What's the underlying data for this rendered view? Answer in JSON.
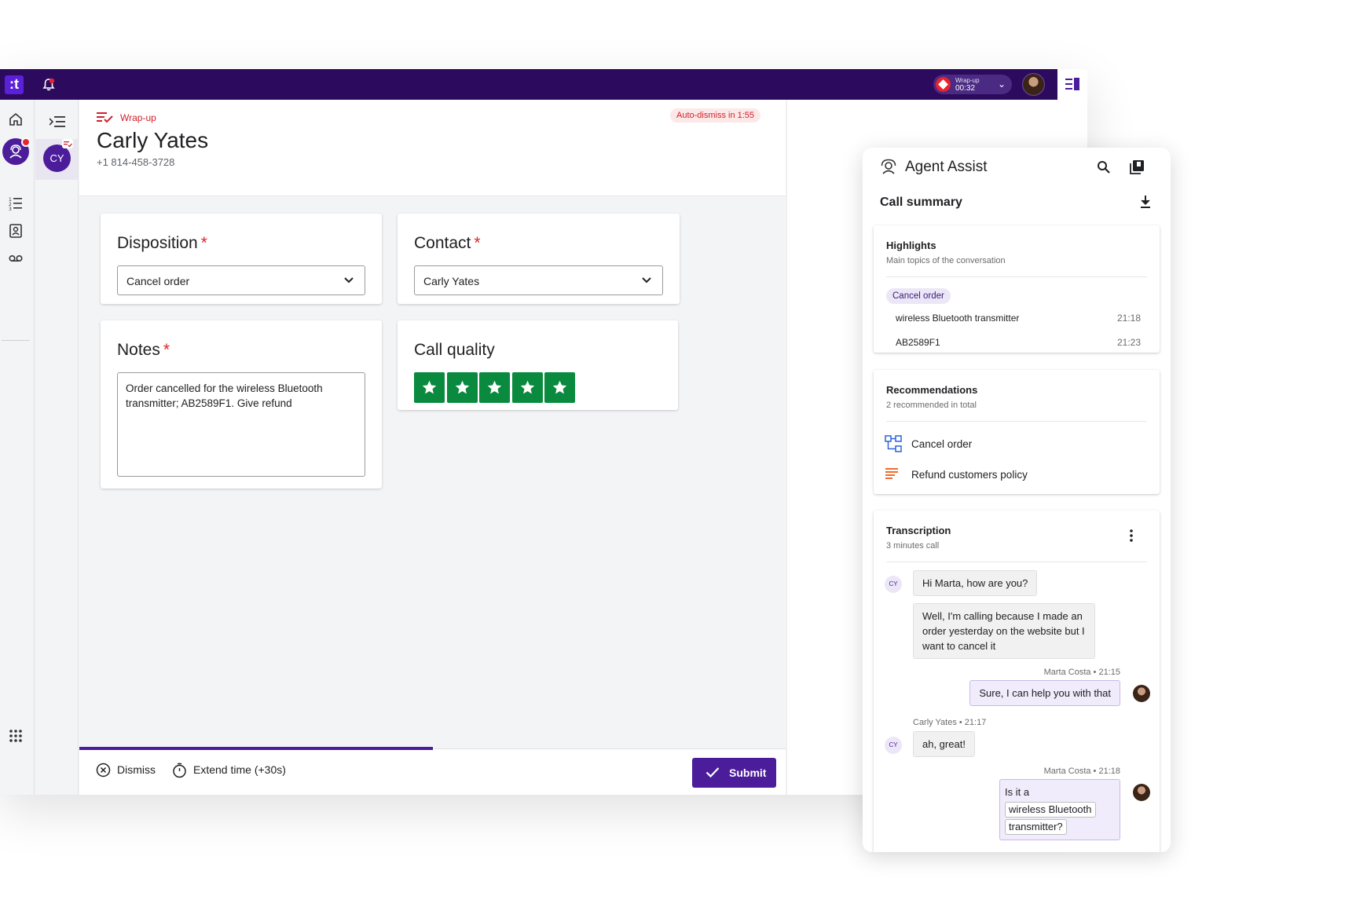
{
  "topbar": {
    "logo_text": ":t",
    "status_label": "Wrap-up",
    "status_time": "00:32"
  },
  "secondary_rail": {
    "contact_initials": "CY"
  },
  "header": {
    "wrap_up_label": "Wrap-up",
    "contact_name": "Carly Yates",
    "contact_phone": "+1 814-458-3728",
    "auto_dismiss": "Auto-dismiss in 1:55"
  },
  "form": {
    "disposition": {
      "label": "Disposition",
      "required_mark": "*",
      "value": "Cancel order"
    },
    "contact": {
      "label": "Contact",
      "required_mark": "*",
      "value": "Carly Yates"
    },
    "notes": {
      "label": "Notes",
      "required_mark": "*",
      "value": "Order cancelled for the wireless Bluetooth transmitter; AB2589F1. Give refund"
    },
    "call_quality": {
      "label": "Call quality",
      "rating": 5,
      "max": 5
    }
  },
  "footer": {
    "dismiss_label": "Dismiss",
    "extend_label": "Extend time (+30s)",
    "submit_label": "Submit",
    "progress_fraction": 0.5
  },
  "assist": {
    "title": "Agent Assist",
    "summary_title": "Call summary",
    "highlights": {
      "title": "Highlights",
      "subtitle": "Main topics of the conversation",
      "chip": "Cancel order",
      "items": [
        {
          "text": "wireless Bluetooth transmitter",
          "time": "21:18"
        },
        {
          "text": "AB2589F1",
          "time": "21:23"
        }
      ]
    },
    "recommendations": {
      "title": "Recommendations",
      "subtitle": "2 recommended in total",
      "items": [
        {
          "text": "Cancel order",
          "icon": "workflow-icon"
        },
        {
          "text": "Refund customers policy",
          "icon": "article-icon"
        }
      ]
    },
    "transcription": {
      "title": "Transcription",
      "subtitle": "3 minutes call",
      "customer_initials": "CY",
      "messages": [
        {
          "text": "Hi Marta, how are you?"
        },
        {
          "text": "Well, I'm calling because I made an order yesterday on the website but I want to cancel it"
        },
        {
          "meta": "Marta Costa • 21:15",
          "text": "Sure, I can help you with that"
        },
        {
          "meta": "Carly Yates • 21:17",
          "text": "ah, great!"
        },
        {
          "meta": "Marta Costa • 21:18",
          "text_prefix": "Is it a",
          "keyword_1": "wireless Bluetooth",
          "keyword_2": "transmitter?"
        }
      ]
    }
  },
  "colors": {
    "topbar": "#2c0a5e",
    "brand": "#4b1d9a",
    "required": "#e02424",
    "star": "#0a8a3e"
  }
}
